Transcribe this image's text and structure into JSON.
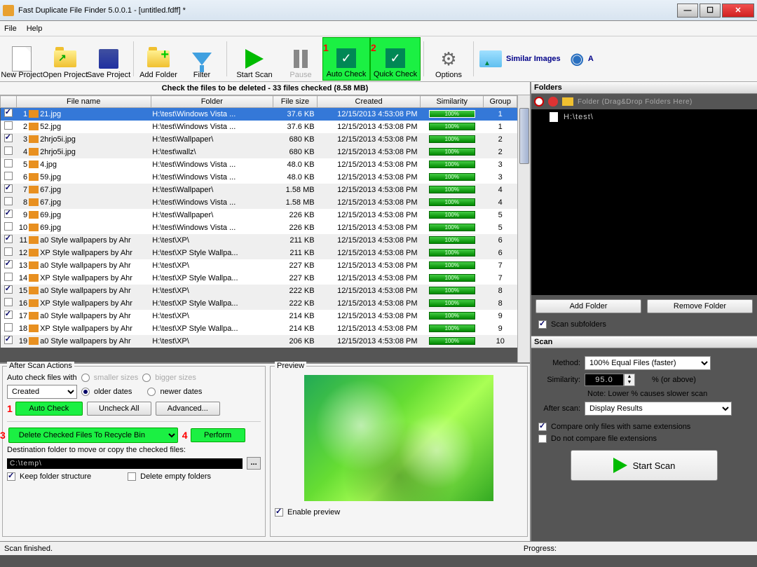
{
  "title": "Fast Duplicate File Finder 5.0.0.1 - [untitled.fdff] *",
  "menu": {
    "file": "File",
    "help": "Help"
  },
  "toolbar": {
    "new_project": "New Project",
    "open_project": "Open Project",
    "save_project": "Save Project",
    "add_folder": "Add Folder",
    "filter": "Filter",
    "start_scan": "Start Scan",
    "pause": "Pause",
    "auto_check": "Auto Check",
    "quick_check": "Quick Check",
    "options": "Options",
    "similar_images": "Similar Images",
    "a_label": "A"
  },
  "check_header": "Check the files to be deleted - 33 files checked (8.58 MB)",
  "columns": {
    "filename": "File name",
    "folder": "Folder",
    "filesize": "File size",
    "created": "Created",
    "similarity": "Similarity",
    "group": "Group"
  },
  "rows": [
    {
      "n": 1,
      "ck": true,
      "sel": true,
      "fname": "21.jpg",
      "folder": "H:\\test\\Windows Vista ...",
      "size": "37.6 KB",
      "created": "12/15/2013 4:53:08 PM",
      "sim": "100%",
      "grp": 1
    },
    {
      "n": 2,
      "ck": false,
      "fname": "52.jpg",
      "folder": "H:\\test\\Windows Vista ...",
      "size": "37.6 KB",
      "created": "12/15/2013 4:53:08 PM",
      "sim": "100%",
      "grp": 1
    },
    {
      "n": 3,
      "ck": true,
      "fname": "2hrjo5i.jpg",
      "folder": "H:\\test\\Wallpaper\\",
      "size": "680 KB",
      "created": "12/15/2013 4:53:08 PM",
      "sim": "100%",
      "grp": 2
    },
    {
      "n": 4,
      "ck": false,
      "fname": "2hrjo5i.jpg",
      "folder": "H:\\test\\wallz\\",
      "size": "680 KB",
      "created": "12/15/2013 4:53:08 PM",
      "sim": "100%",
      "grp": 2
    },
    {
      "n": 5,
      "ck": false,
      "fname": "4.jpg",
      "folder": "H:\\test\\Windows Vista ...",
      "size": "48.0 KB",
      "created": "12/15/2013 4:53:08 PM",
      "sim": "100%",
      "grp": 3
    },
    {
      "n": 6,
      "ck": false,
      "fname": "59.jpg",
      "folder": "H:\\test\\Windows Vista ...",
      "size": "48.0 KB",
      "created": "12/15/2013 4:53:08 PM",
      "sim": "100%",
      "grp": 3
    },
    {
      "n": 7,
      "ck": true,
      "fname": "67.jpg",
      "folder": "H:\\test\\Wallpaper\\",
      "size": "1.58 MB",
      "created": "12/15/2013 4:53:08 PM",
      "sim": "100%",
      "grp": 4
    },
    {
      "n": 8,
      "ck": false,
      "fname": "67.jpg",
      "folder": "H:\\test\\Windows Vista ...",
      "size": "1.58 MB",
      "created": "12/15/2013 4:53:08 PM",
      "sim": "100%",
      "grp": 4
    },
    {
      "n": 9,
      "ck": true,
      "fname": "69.jpg",
      "folder": "H:\\test\\Wallpaper\\",
      "size": "226 KB",
      "created": "12/15/2013 4:53:08 PM",
      "sim": "100%",
      "grp": 5
    },
    {
      "n": 10,
      "ck": false,
      "fname": "69.jpg",
      "folder": "H:\\test\\Windows Vista ...",
      "size": "226 KB",
      "created": "12/15/2013 4:53:08 PM",
      "sim": "100%",
      "grp": 5
    },
    {
      "n": 11,
      "ck": true,
      "fname": "a0 Style wallpapers by Ahr",
      "folder": "H:\\test\\XP\\",
      "size": "211 KB",
      "created": "12/15/2013 4:53:08 PM",
      "sim": "100%",
      "grp": 6
    },
    {
      "n": 12,
      "ck": false,
      "fname": "XP Style wallpapers by Ahr",
      "folder": "H:\\test\\XP Style Wallpa...",
      "size": "211 KB",
      "created": "12/15/2013 4:53:08 PM",
      "sim": "100%",
      "grp": 6
    },
    {
      "n": 13,
      "ck": true,
      "fname": "a0 Style wallpapers by Ahr",
      "folder": "H:\\test\\XP\\",
      "size": "227 KB",
      "created": "12/15/2013 4:53:08 PM",
      "sim": "100%",
      "grp": 7
    },
    {
      "n": 14,
      "ck": false,
      "fname": "XP Style wallpapers by Ahr",
      "folder": "H:\\test\\XP Style Wallpa...",
      "size": "227 KB",
      "created": "12/15/2013 4:53:08 PM",
      "sim": "100%",
      "grp": 7
    },
    {
      "n": 15,
      "ck": true,
      "fname": "a0 Style wallpapers by Ahr",
      "folder": "H:\\test\\XP\\",
      "size": "222 KB",
      "created": "12/15/2013 4:53:08 PM",
      "sim": "100%",
      "grp": 8
    },
    {
      "n": 16,
      "ck": false,
      "fname": "XP Style wallpapers by Ahr",
      "folder": "H:\\test\\XP Style Wallpa...",
      "size": "222 KB",
      "created": "12/15/2013 4:53:08 PM",
      "sim": "100%",
      "grp": 8
    },
    {
      "n": 17,
      "ck": true,
      "fname": "a0 Style wallpapers by Ahr",
      "folder": "H:\\test\\XP\\",
      "size": "214 KB",
      "created": "12/15/2013 4:53:08 PM",
      "sim": "100%",
      "grp": 9
    },
    {
      "n": 18,
      "ck": false,
      "fname": "XP Style wallpapers by Ahr",
      "folder": "H:\\test\\XP Style Wallpa...",
      "size": "214 KB",
      "created": "12/15/2013 4:53:08 PM",
      "sim": "100%",
      "grp": 9
    },
    {
      "n": 19,
      "ck": true,
      "fname": "a0 Style wallpapers by Ahr",
      "folder": "H:\\test\\XP\\",
      "size": "206 KB",
      "created": "12/15/2013 4:53:08 PM",
      "sim": "100%",
      "grp": 10
    }
  ],
  "after": {
    "legend": "After Scan Actions",
    "auto_label": "Auto check files with",
    "smaller": "smaller sizes",
    "bigger": "bigger sizes",
    "older": "older dates",
    "newer": "newer dates",
    "criteria": "Created",
    "auto_btn": "Auto Check",
    "uncheck": "Uncheck All",
    "advanced": "Advanced...",
    "action": "Delete Checked Files To Recycle Bin",
    "perform": "Perform",
    "dest_label": "Destination folder to move or copy the checked files:",
    "dest_path": "C:\\temp\\",
    "keep": "Keep folder structure",
    "empty": "Delete empty folders"
  },
  "preview": {
    "legend": "Preview",
    "enable": "Enable preview"
  },
  "folders": {
    "header": "Folders",
    "drag": "Folder (Drag&Drop Folders Here)",
    "path": "H:\\test\\",
    "add": "Add Folder",
    "remove": "Remove Folder",
    "scan_sub": "Scan subfolders"
  },
  "scan": {
    "header": "Scan",
    "method_l": "Method:",
    "method_v": "100% Equal Files (faster)",
    "sim_l": "Similarity:",
    "sim_v": "95.0",
    "sim_sfx": "%  (or above)",
    "note": "Note: Lower % causes slower scan",
    "after_l": "After scan:",
    "after_v": "Display Results",
    "cmp_ext": "Compare only files with same extensions",
    "no_ext": "Do not compare file extensions",
    "start": "Start Scan"
  },
  "status": {
    "left": "Scan finished.",
    "prog": "Progress:"
  }
}
